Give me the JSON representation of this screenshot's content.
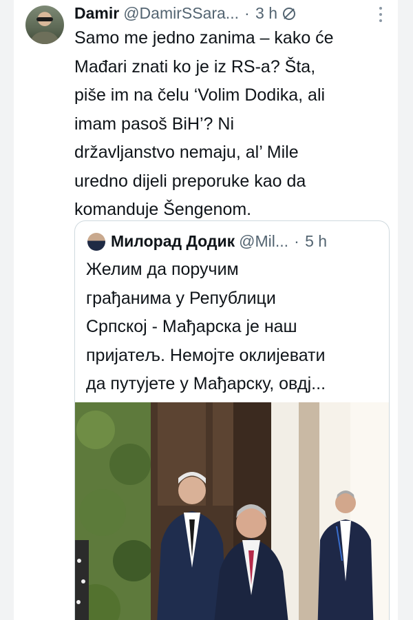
{
  "tweet": {
    "author_name": "Damir",
    "author_handle": "@DamirSSara...",
    "separator": "·",
    "time": "3 h",
    "text_lines": [
      "Samo me jedno zanima – kako će",
      "Mađari znati ko je iz RS-a? Šta,",
      "piše im na čelu ‘Volim Dodika, ali",
      "imam pasoš BiH’? Ni",
      "državljanstvo nemaju, al’ Mile",
      "uredno dijeli preporuke kao da",
      "komanduje Šengenom."
    ]
  },
  "quote": {
    "author_name": "Милорад Додик",
    "author_handle": "@Mil...",
    "separator": "·",
    "time": "5 h",
    "text_lines": [
      "Желим да поручим",
      "грађанима у Републици",
      "Српској - Мађарска је наш",
      "пријатељ. Немојте оклијевати",
      "да путујете у Мађарску, овдј..."
    ]
  },
  "icons": {
    "mute": "mute-icon",
    "more": "more-options-icon"
  },
  "colors": {
    "text_primary": "#0f1419",
    "text_secondary": "#536471",
    "card_border": "#cfd9de"
  }
}
